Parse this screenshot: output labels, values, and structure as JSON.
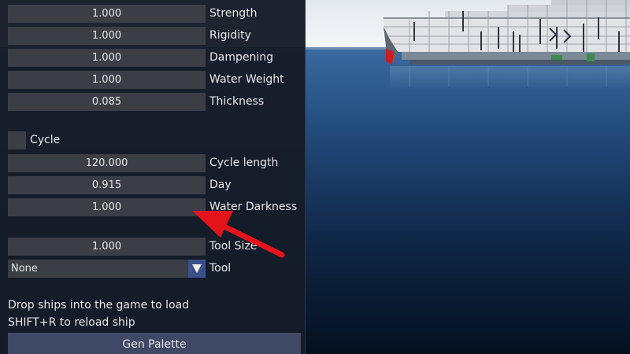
{
  "settings_panel": {
    "fields": [
      {
        "value": "1.000",
        "label": "Strength"
      },
      {
        "value": "1.000",
        "label": "Rigidity"
      },
      {
        "value": "1.000",
        "label": "Dampening"
      },
      {
        "value": "1.000",
        "label": "Water Weight"
      },
      {
        "value": "0.085",
        "label": "Thickness"
      }
    ],
    "cycle": {
      "label": "Cycle",
      "checked": false
    },
    "cycle_fields": [
      {
        "value": "120.000",
        "label": "Cycle length"
      },
      {
        "value": "0.915",
        "label": "Day"
      },
      {
        "value": "1.000",
        "label": "Water Darkness"
      }
    ],
    "tool_size": {
      "value": "1.000",
      "label": "Tool Size"
    },
    "tool": {
      "selected": "None",
      "label": "Tool"
    },
    "info_lines": [
      "Drop ships into the game to load",
      "SHIFT+R to reload ship"
    ],
    "gen_palette_label": "Gen Palette"
  },
  "colors": {
    "panel_bg": "#161c28",
    "field_bg": "#3b3e45",
    "dropdown_accent": "#3b4f8d",
    "button_bg": "#3f4864",
    "annotation_arrow": "#e3141c",
    "sky": "#eef2f6",
    "water_top": "#2f5d92",
    "water_bottom": "#04101f"
  },
  "icons": {
    "dropdown": "triangle-down-icon",
    "annotation": "red-arrow-icon"
  }
}
